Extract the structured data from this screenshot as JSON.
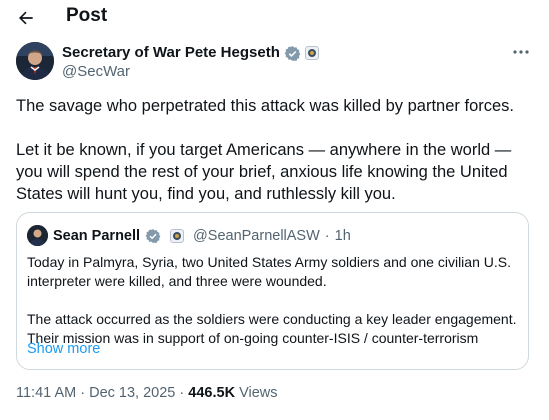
{
  "header": {
    "title": "Post"
  },
  "author": {
    "name": "Secretary of War Pete Hegseth",
    "handle": "@SecWar"
  },
  "post": {
    "paragraphs": [
      "The savage who perpetrated this attack was killed by partner forces.",
      "Let it be known, if you target Americans — anywhere in the world — you will spend the rest of your brief, anxious life knowing the United States will hunt you, find you, and ruthlessly kill you."
    ]
  },
  "quote": {
    "name": "Sean Parnell",
    "handle": "@SeanParnellASW",
    "separator": "·",
    "time": "1h",
    "paragraphs": [
      "Today in Palmyra, Syria, two United States Army soldiers and one civilian U.S. interpreter were killed, and three were wounded.",
      "The attack occurred as the soldiers were conducting a key leader engagement. Their mission was in support of on-going counter-ISIS / counter-terrorism"
    ],
    "show_more": "Show more"
  },
  "meta": {
    "time": "11:41 AM",
    "separator": "·",
    "date": "Dec 13, 2025",
    "views_count": "446.5K",
    "views_label": "Views"
  },
  "colors": {
    "accent": "#1d9bf0",
    "text": "#0f1419",
    "muted": "#536471",
    "border": "#cfd9de"
  },
  "icons": [
    "back-arrow-icon",
    "verified-badge-icon",
    "affiliation-badge-icon",
    "more-options-icon"
  ]
}
